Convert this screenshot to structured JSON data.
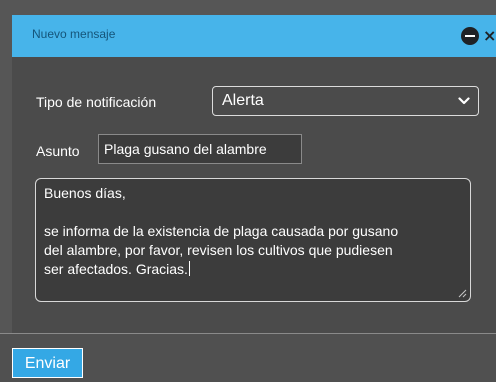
{
  "dialog": {
    "title": "Nuevo mensaje",
    "minimize_icon": "minimize-icon",
    "close_icon": "close-icon",
    "close_glyph": "×"
  },
  "form": {
    "notification_type_label": "Tipo de notificación",
    "notification_type_value": "Alerta",
    "subject_label": "Asunto",
    "subject_value": "Plaga gusano del alambre",
    "message_lines": [
      "Buenos días,",
      "",
      "se informa de la existencia de plaga causada por gusano",
      "del alambre, por favor, revisen los cultivos que pudiesen",
      "ser afectados. Gracias."
    ]
  },
  "footer": {
    "send_label": "Enviar"
  },
  "colors": {
    "titlebar": "#47b4ea",
    "title_text": "#15557a",
    "panel": "#4b4b4b",
    "send_button": "#34a8e5"
  }
}
